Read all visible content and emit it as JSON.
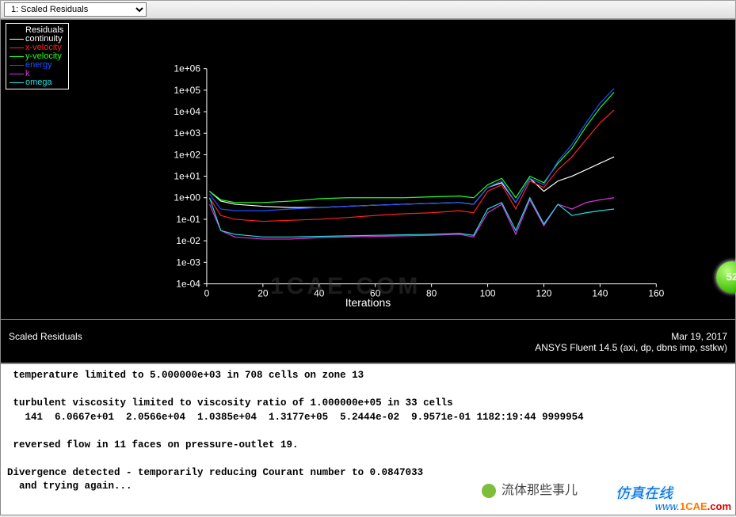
{
  "dropdown": {
    "selected": "1: Scaled Residuals"
  },
  "legend": {
    "title": "Residuals",
    "items": [
      {
        "label": "continuity",
        "color": "#ffffff"
      },
      {
        "label": "x-velocity",
        "color": "#ff2020"
      },
      {
        "label": "y-velocity",
        "color": "#20ff20"
      },
      {
        "label": "energy",
        "color": "#2050ff"
      },
      {
        "label": "k",
        "color": "#e032e0"
      },
      {
        "label": "omega",
        "color": "#20e0e0"
      }
    ]
  },
  "chart_data": {
    "type": "line",
    "title": "Scaled Residuals",
    "xlabel": "Iterations",
    "ylabel": "",
    "xlim": [
      0,
      160
    ],
    "ylim": [
      0.0001,
      1000000.0
    ],
    "yscale": "log",
    "xticks": [
      0,
      20,
      40,
      60,
      80,
      100,
      120,
      140,
      160
    ],
    "yticks": [
      "1e-04",
      "1e-03",
      "1e-02",
      "1e-01",
      "1e+00",
      "1e+01",
      "1e+02",
      "1e+03",
      "1e+04",
      "1e+05",
      "1e+06"
    ],
    "x": [
      1,
      5,
      10,
      20,
      30,
      40,
      50,
      60,
      70,
      80,
      90,
      95,
      100,
      105,
      110,
      115,
      120,
      125,
      130,
      135,
      140,
      145
    ],
    "series": [
      {
        "name": "continuity",
        "color": "#ffffff",
        "values": [
          2.0,
          0.7,
          0.5,
          0.4,
          0.35,
          0.35,
          0.4,
          0.45,
          0.5,
          0.55,
          0.6,
          0.5,
          3.0,
          5.0,
          0.6,
          8.0,
          2.0,
          6.0,
          10,
          20,
          40,
          80
        ]
      },
      {
        "name": "x-velocity",
        "color": "#ff2020",
        "values": [
          1.0,
          0.15,
          0.1,
          0.08,
          0.09,
          0.1,
          0.12,
          0.15,
          0.18,
          0.2,
          0.25,
          0.2,
          2.0,
          4.0,
          0.3,
          6.0,
          3.0,
          20,
          80,
          500,
          3000,
          12000.0
        ]
      },
      {
        "name": "y-velocity",
        "color": "#20ff20",
        "values": [
          2.0,
          0.8,
          0.6,
          0.6,
          0.7,
          0.9,
          1.0,
          1.0,
          1.0,
          1.1,
          1.2,
          1.0,
          4.0,
          8.0,
          1.0,
          10,
          5.0,
          40,
          200,
          2000,
          15000.0,
          80000.0
        ]
      },
      {
        "name": "energy",
        "color": "#2050ff",
        "values": [
          1.5,
          0.3,
          0.25,
          0.25,
          0.3,
          0.35,
          0.4,
          0.45,
          0.5,
          0.55,
          0.6,
          0.5,
          3.0,
          6.0,
          0.6,
          8.0,
          4.0,
          50,
          300,
          3000,
          25000.0,
          120000.0
        ]
      },
      {
        "name": "k",
        "color": "#e032e0",
        "values": [
          0.5,
          0.03,
          0.015,
          0.012,
          0.012,
          0.014,
          0.015,
          0.016,
          0.017,
          0.018,
          0.02,
          0.015,
          0.2,
          0.5,
          0.02,
          0.8,
          0.05,
          0.5,
          0.3,
          0.6,
          0.8,
          1.0
        ]
      },
      {
        "name": "omega",
        "color": "#20e0e0",
        "values": [
          1.0,
          0.03,
          0.02,
          0.015,
          0.015,
          0.016,
          0.017,
          0.018,
          0.019,
          0.02,
          0.022,
          0.018,
          0.3,
          0.6,
          0.03,
          1.0,
          0.06,
          0.5,
          0.15,
          0.2,
          0.25,
          0.3
        ]
      }
    ]
  },
  "footer": {
    "left": "Scaled Residuals",
    "date": "Mar 19, 2017",
    "right2": "ANSYS Fluent 14.5 (axi, dp, dbns imp, sstkw)"
  },
  "console_lines": [
    " temperature limited to 5.000000e+03 in 708 cells on zone 13",
    "",
    " turbulent viscosity limited to viscosity ratio of 1.000000e+05 in 33 cells",
    "   141  6.0667e+01  2.0566e+04  1.0385e+04  1.3177e+05  5.2444e-02  9.9571e-01 1182:19:44 9999954",
    "",
    " reversed flow in 11 faces on pressure-outlet 19.",
    "",
    "Divergence detected - temporarily reducing Courant number to 0.0847033",
    "  and trying again..."
  ],
  "badge": "52",
  "watermarks": {
    "a": "1CAE.COM",
    "b_label": "www.",
    "b_domain": "1CAE",
    "b_tld": ".com",
    "c": "仿真在线",
    "d": "流体那些事儿"
  }
}
